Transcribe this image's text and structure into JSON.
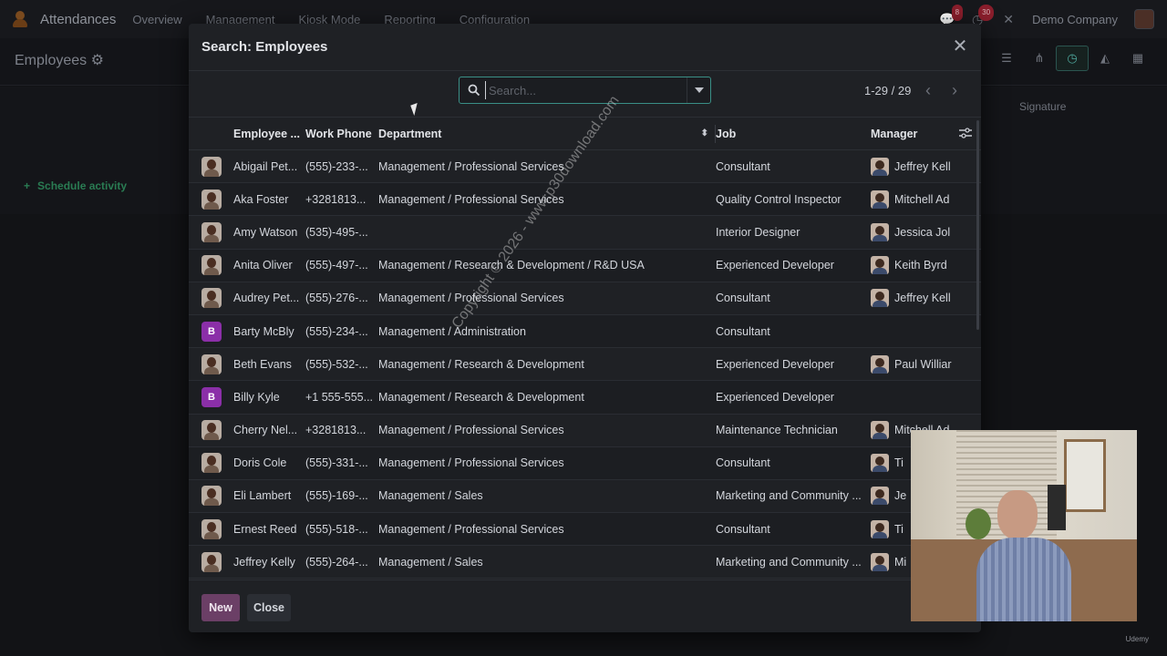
{
  "navbar": {
    "app_name": "Attendances",
    "menu": [
      "Overview",
      "Management",
      "Kiosk Mode",
      "Reporting",
      "Configuration"
    ],
    "messages_badge": "8",
    "activities_badge": "30",
    "company": "Demo Company"
  },
  "control_panel": {
    "title": "Employees",
    "signature_column": "Signature",
    "schedule_activity": "Schedule activity"
  },
  "modal": {
    "title": "Search: Employees",
    "search_placeholder": "Search...",
    "pager": "1-29 / 29",
    "columns": [
      "Employee ...",
      "Work Phone",
      "Department",
      "Job",
      "Manager"
    ],
    "rows": [
      {
        "avatar": "photo",
        "name": "Abigail Pet...",
        "phone": "(555)-233-...",
        "department": "Management / Professional Services",
        "job": "Consultant",
        "manager": "Jeffrey Kell"
      },
      {
        "avatar": "photo",
        "name": "Aka Foster",
        "phone": "+3281813...",
        "department": "Management / Professional Services",
        "job": "Quality Control Inspector",
        "manager": "Mitchell Ad"
      },
      {
        "avatar": "photo",
        "name": "Amy Watson",
        "phone": "(535)-495-...",
        "department": "",
        "job": "Interior Designer",
        "manager": "Jessica Jol"
      },
      {
        "avatar": "photo",
        "name": "Anita Oliver",
        "phone": "(555)-497-...",
        "department": "Management / Research & Development / R&D USA",
        "job": "Experienced Developer",
        "manager": "Keith Byrd"
      },
      {
        "avatar": "photo",
        "name": "Audrey Pet...",
        "phone": "(555)-276-...",
        "department": "Management / Professional Services",
        "job": "Consultant",
        "manager": "Jeffrey Kell"
      },
      {
        "avatar": "B",
        "name": "Barty McBly",
        "phone": "(555)-234-...",
        "department": "Management / Administration",
        "job": "Consultant",
        "manager": ""
      },
      {
        "avatar": "photo",
        "name": "Beth Evans",
        "phone": "(555)-532-...",
        "department": "Management / Research & Development",
        "job": "Experienced Developer",
        "manager": "Paul Williar"
      },
      {
        "avatar": "B",
        "name": "Billy Kyle",
        "phone": "+1 555-555...",
        "department": "Management / Research & Development",
        "job": "Experienced Developer",
        "manager": ""
      },
      {
        "avatar": "photo",
        "name": "Cherry Nel...",
        "phone": "+3281813...",
        "department": "Management / Professional Services",
        "job": "Maintenance Technician",
        "manager": "Mitchell Ad"
      },
      {
        "avatar": "photo",
        "name": "Doris Cole",
        "phone": "(555)-331-...",
        "department": "Management / Professional Services",
        "job": "Consultant",
        "manager": "Ti"
      },
      {
        "avatar": "photo",
        "name": "Eli Lambert",
        "phone": "(555)-169-...",
        "department": "Management / Sales",
        "job": "Marketing and Community ...",
        "manager": "Je"
      },
      {
        "avatar": "photo",
        "name": "Ernest Reed",
        "phone": "(555)-518-...",
        "department": "Management / Professional Services",
        "job": "Consultant",
        "manager": "Ti"
      },
      {
        "avatar": "photo",
        "name": "Jeffrey Kelly",
        "phone": "(555)-264-...",
        "department": "Management / Sales",
        "job": "Marketing and Community ...",
        "manager": "Mi"
      }
    ],
    "new_label": "New",
    "close_label": "Close"
  },
  "watermark": "Copyright © 2026 - www.p30download.com",
  "brand": "Udemy",
  "colors": {
    "accent_teal": "#3a8f86",
    "primary_button": "#6b3f66",
    "letter_avatar": "#8b2fa8"
  }
}
